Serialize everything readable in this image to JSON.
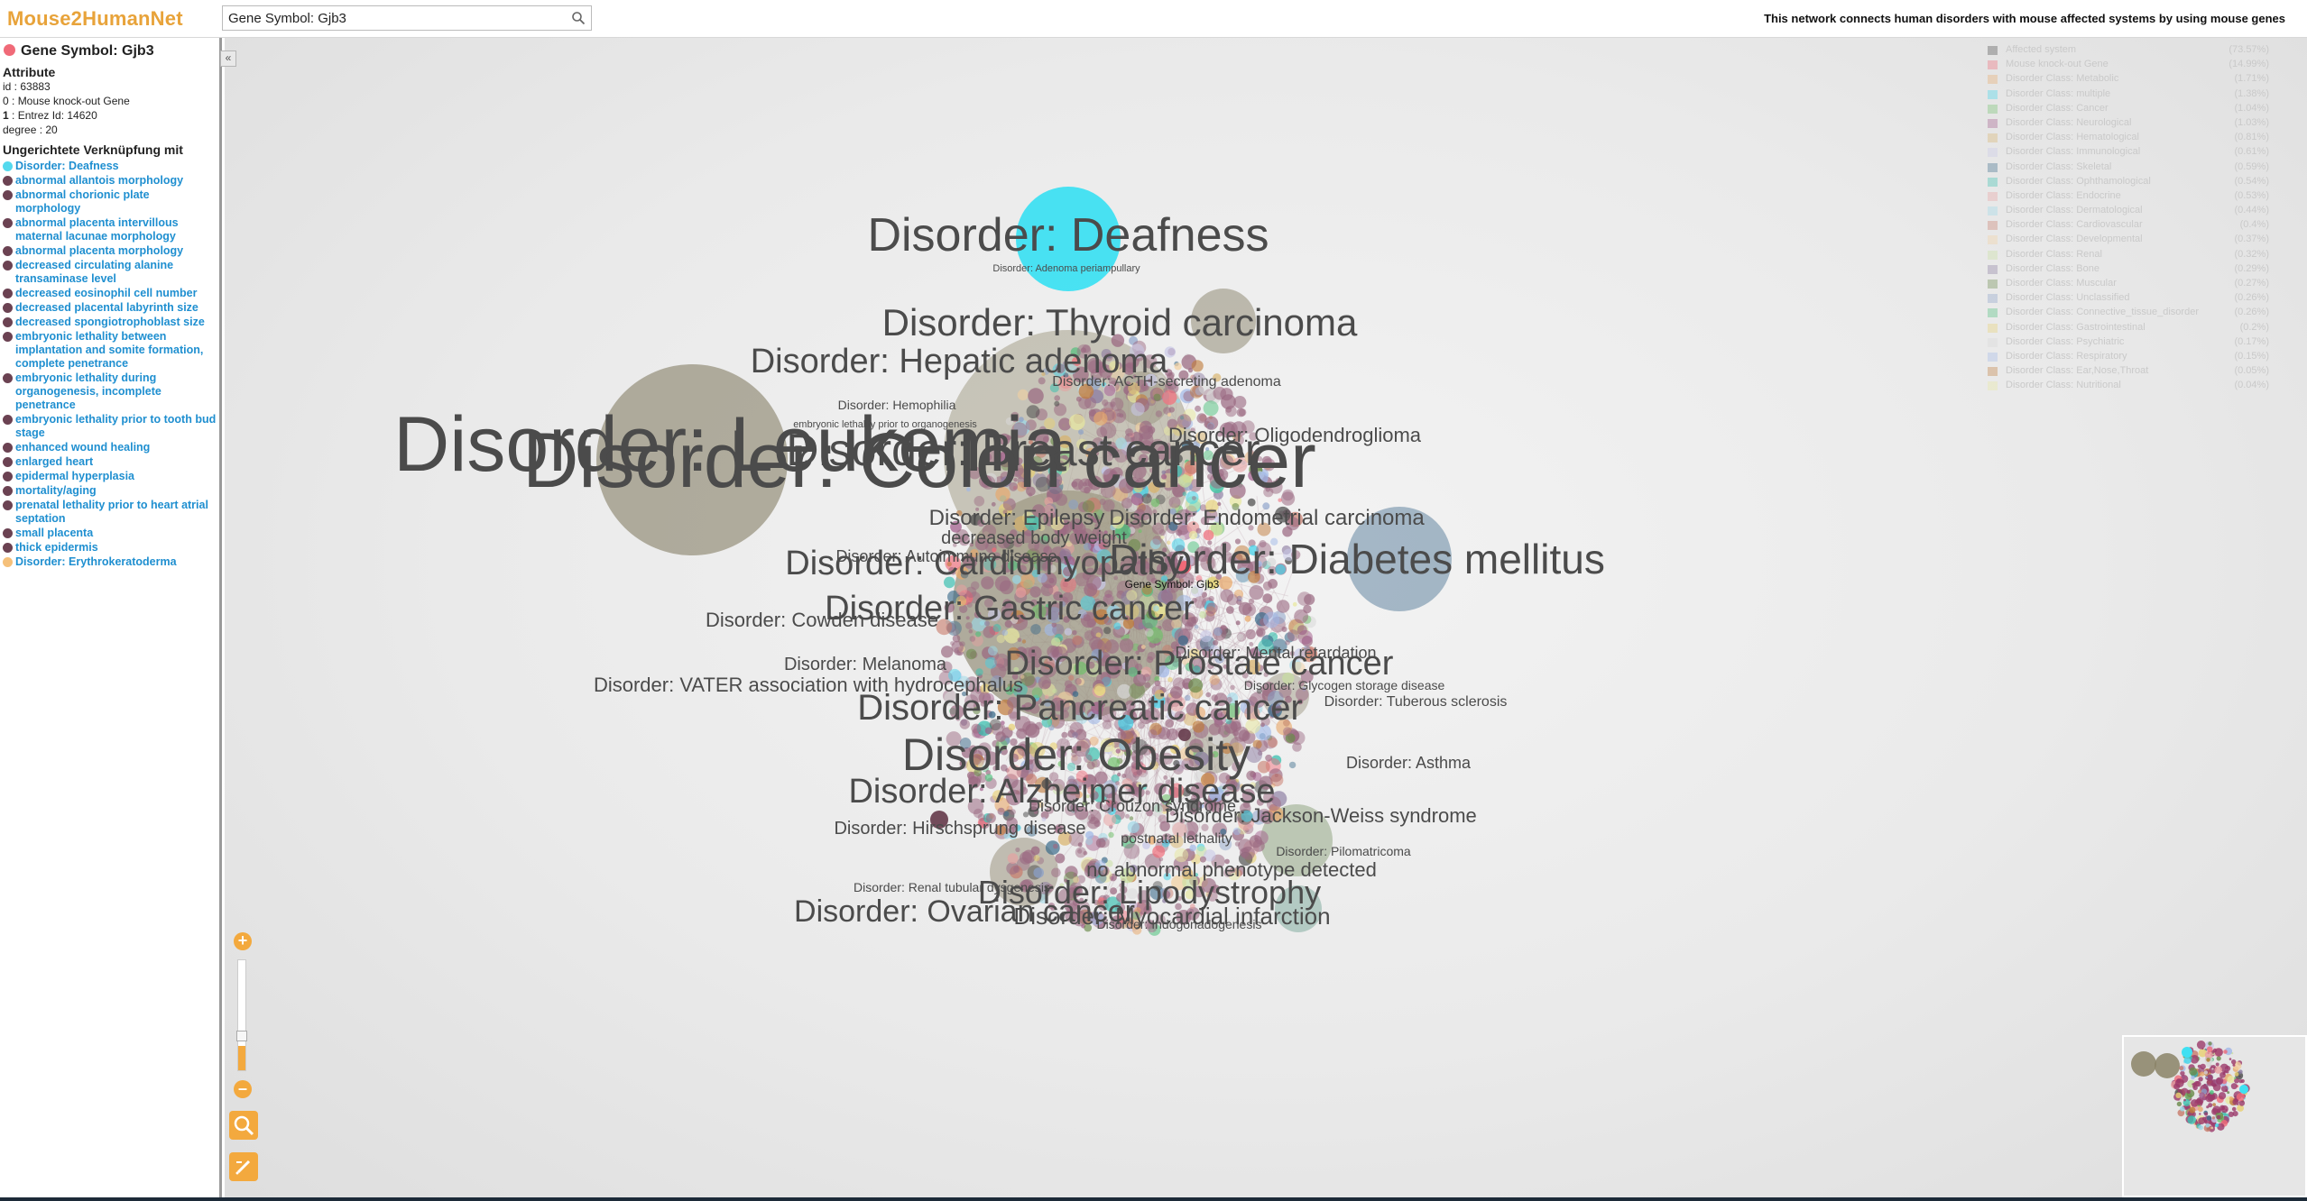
{
  "app": {
    "title": "Mouse2HumanNet",
    "search_value": "Gene Symbol: Gjb3",
    "description": "This network connects human disorders with mouse affected systems by using mouse genes",
    "collapse_symbol": "«"
  },
  "sidebar": {
    "node_title": "Gene Symbol: Gjb3",
    "attribute_heading": "Attribute",
    "attributes": [
      {
        "key": "id",
        "value": " : 63883"
      },
      {
        "key": "0",
        "value": " : Mouse knock-out Gene"
      },
      {
        "key": "1",
        "value": " : Entrez Id: 14620"
      },
      {
        "key": "degree",
        "value": " : 20"
      }
    ],
    "links_heading": "Ungerichtete Verknüpfung mit",
    "links": [
      "Disorder: Deafness",
      "abnormal allantois morphology",
      "abnormal chorionic plate morphology",
      "abnormal placenta intervillous maternal lacunae morphology",
      "abnormal placenta morphology",
      "decreased circulating alanine transaminase level",
      "decreased eosinophil cell number",
      "decreased placental labyrinth size",
      "decreased spongiotrophoblast size",
      "embryonic lethality between implantation and somite formation, complete penetrance",
      "embryonic lethality during organogenesis, incomplete penetrance",
      "embryonic lethality prior to tooth bud stage",
      "enhanced wound healing",
      "enlarged heart",
      "epidermal hyperplasia",
      "mortality/aging",
      "prenatal lethality prior to heart atrial septation",
      "small placenta",
      "thick epidermis",
      "Disorder: Erythrokeratoderma"
    ]
  },
  "graph": {
    "selected_node_label": "Gene Symbol: Gjb3",
    "large_labels": [
      "Disorder: Deafness",
      "Disorder: Thyroid carcinoma",
      "Disorder: Hepatic adenoma",
      "Disorder: Leukemia",
      "Disorder: Colon cancer",
      "Disorder: Breast cancer",
      "Disorder: Diabetes mellitus",
      "Disorder: Cardiomyopathy",
      "Disorder: Gastric cancer",
      "Disorder: Prostate cancer",
      "Disorder: Pancreatic cancer",
      "Disorder: Obesity",
      "Disorder: Alzheimer disease",
      "Disorder: Lipodystrophy",
      "Disorder: Ovarian cancer",
      "Disorder: Myocardial infarction",
      "Disorder: Epilepsy",
      "Disorder: Endometrial carcinoma",
      "Disorder: Oligodendroglioma",
      "Disorder: VATER association with hydrocephalus",
      "Disorder: Melanoma",
      "Disorder: Cowden disease",
      "Disorder: Hirschsprung disease",
      "Disorder: Asthma",
      "no abnormal phenotype detected",
      "Disorder: Tuberous sclerosis",
      "Disorder: Glycogen storage disease",
      "Disorder: Indogonadogenesis",
      "Disorder: Renal tubular dysgenesis",
      "Disorder: Adenoma periampullary",
      "Disorder: Hemophilia",
      "Disorder: Pilomatricoma",
      "decreased body weight",
      "postnatal lethality",
      "Disorder: Autoimmune disease",
      "Disorder: Jackson-Weiss syndrome",
      "Disorder: Crouzon syndrome",
      "Disorder: ACTH-secreting adenoma",
      "Disorder: Mental retardation",
      "embryonic lethality prior to organogenesis"
    ]
  },
  "legend": [
    {
      "name": "Affected system",
      "pct": "(73.57%)",
      "color": "#4a4a4a"
    },
    {
      "name": "Mouse knock-out Gene",
      "pct": "(14.99%)",
      "color": "#f06a78"
    },
    {
      "name": "Disorder Class: Metabolic",
      "pct": "(1.71%)",
      "color": "#e8a86a"
    },
    {
      "name": "Disorder Class: multiple",
      "pct": "(1.38%)",
      "color": "#3fd3ea"
    },
    {
      "name": "Disorder Class: Cancer",
      "pct": "(1.04%)",
      "color": "#6fc06a"
    },
    {
      "name": "Disorder Class: Neurological",
      "pct": "(1.03%)",
      "color": "#a05a8a"
    },
    {
      "name": "Disorder Class: Hematological",
      "pct": "(0.81%)",
      "color": "#d8b26a"
    },
    {
      "name": "Disorder Class: Immunological",
      "pct": "(0.61%)",
      "color": "#c8c8e8"
    },
    {
      "name": "Disorder Class: Skeletal",
      "pct": "(0.59%)",
      "color": "#3a6a8a"
    },
    {
      "name": "Disorder Class: Ophthamological",
      "pct": "(0.54%)",
      "color": "#3ac0b0"
    },
    {
      "name": "Disorder Class: Endocrine",
      "pct": "(0.53%)",
      "color": "#e8a0a0"
    },
    {
      "name": "Disorder Class: Dermatological",
      "pct": "(0.44%)",
      "color": "#9ad8e8"
    },
    {
      "name": "Disorder Class: Cardiovascular",
      "pct": "(0.4%)",
      "color": "#c87a6a"
    },
    {
      "name": "Disorder Class: Developmental",
      "pct": "(0.37%)",
      "color": "#f3d0a0"
    },
    {
      "name": "Disorder Class: Renal",
      "pct": "(0.32%)",
      "color": "#c8e0a0"
    },
    {
      "name": "Disorder Class: Bone",
      "pct": "(0.29%)",
      "color": "#8a7aa0"
    },
    {
      "name": "Disorder Class: Muscular",
      "pct": "(0.27%)",
      "color": "#6a8a4a"
    },
    {
      "name": "Disorder Class: Unclassified",
      "pct": "(0.26%)",
      "color": "#8aa0c8"
    },
    {
      "name": "Disorder Class: Connective_tissue_disorder",
      "pct": "(0.26%)",
      "color": "#4ac07a"
    },
    {
      "name": "Disorder Class: Gastrointestinal",
      "pct": "(0.2%)",
      "color": "#e8d070"
    },
    {
      "name": "Disorder Class: Psychiatric",
      "pct": "(0.17%)",
      "color": "#d8d8d8"
    },
    {
      "name": "Disorder Class: Respiratory",
      "pct": "(0.15%)",
      "color": "#a0b8e8"
    },
    {
      "name": "Disorder Class: Ear,Nose,Throat",
      "pct": "(0.05%)",
      "color": "#c07a3a"
    },
    {
      "name": "Disorder Class: Nutritional",
      "pct": "(0.04%)",
      "color": "#e8e8a0"
    }
  ]
}
